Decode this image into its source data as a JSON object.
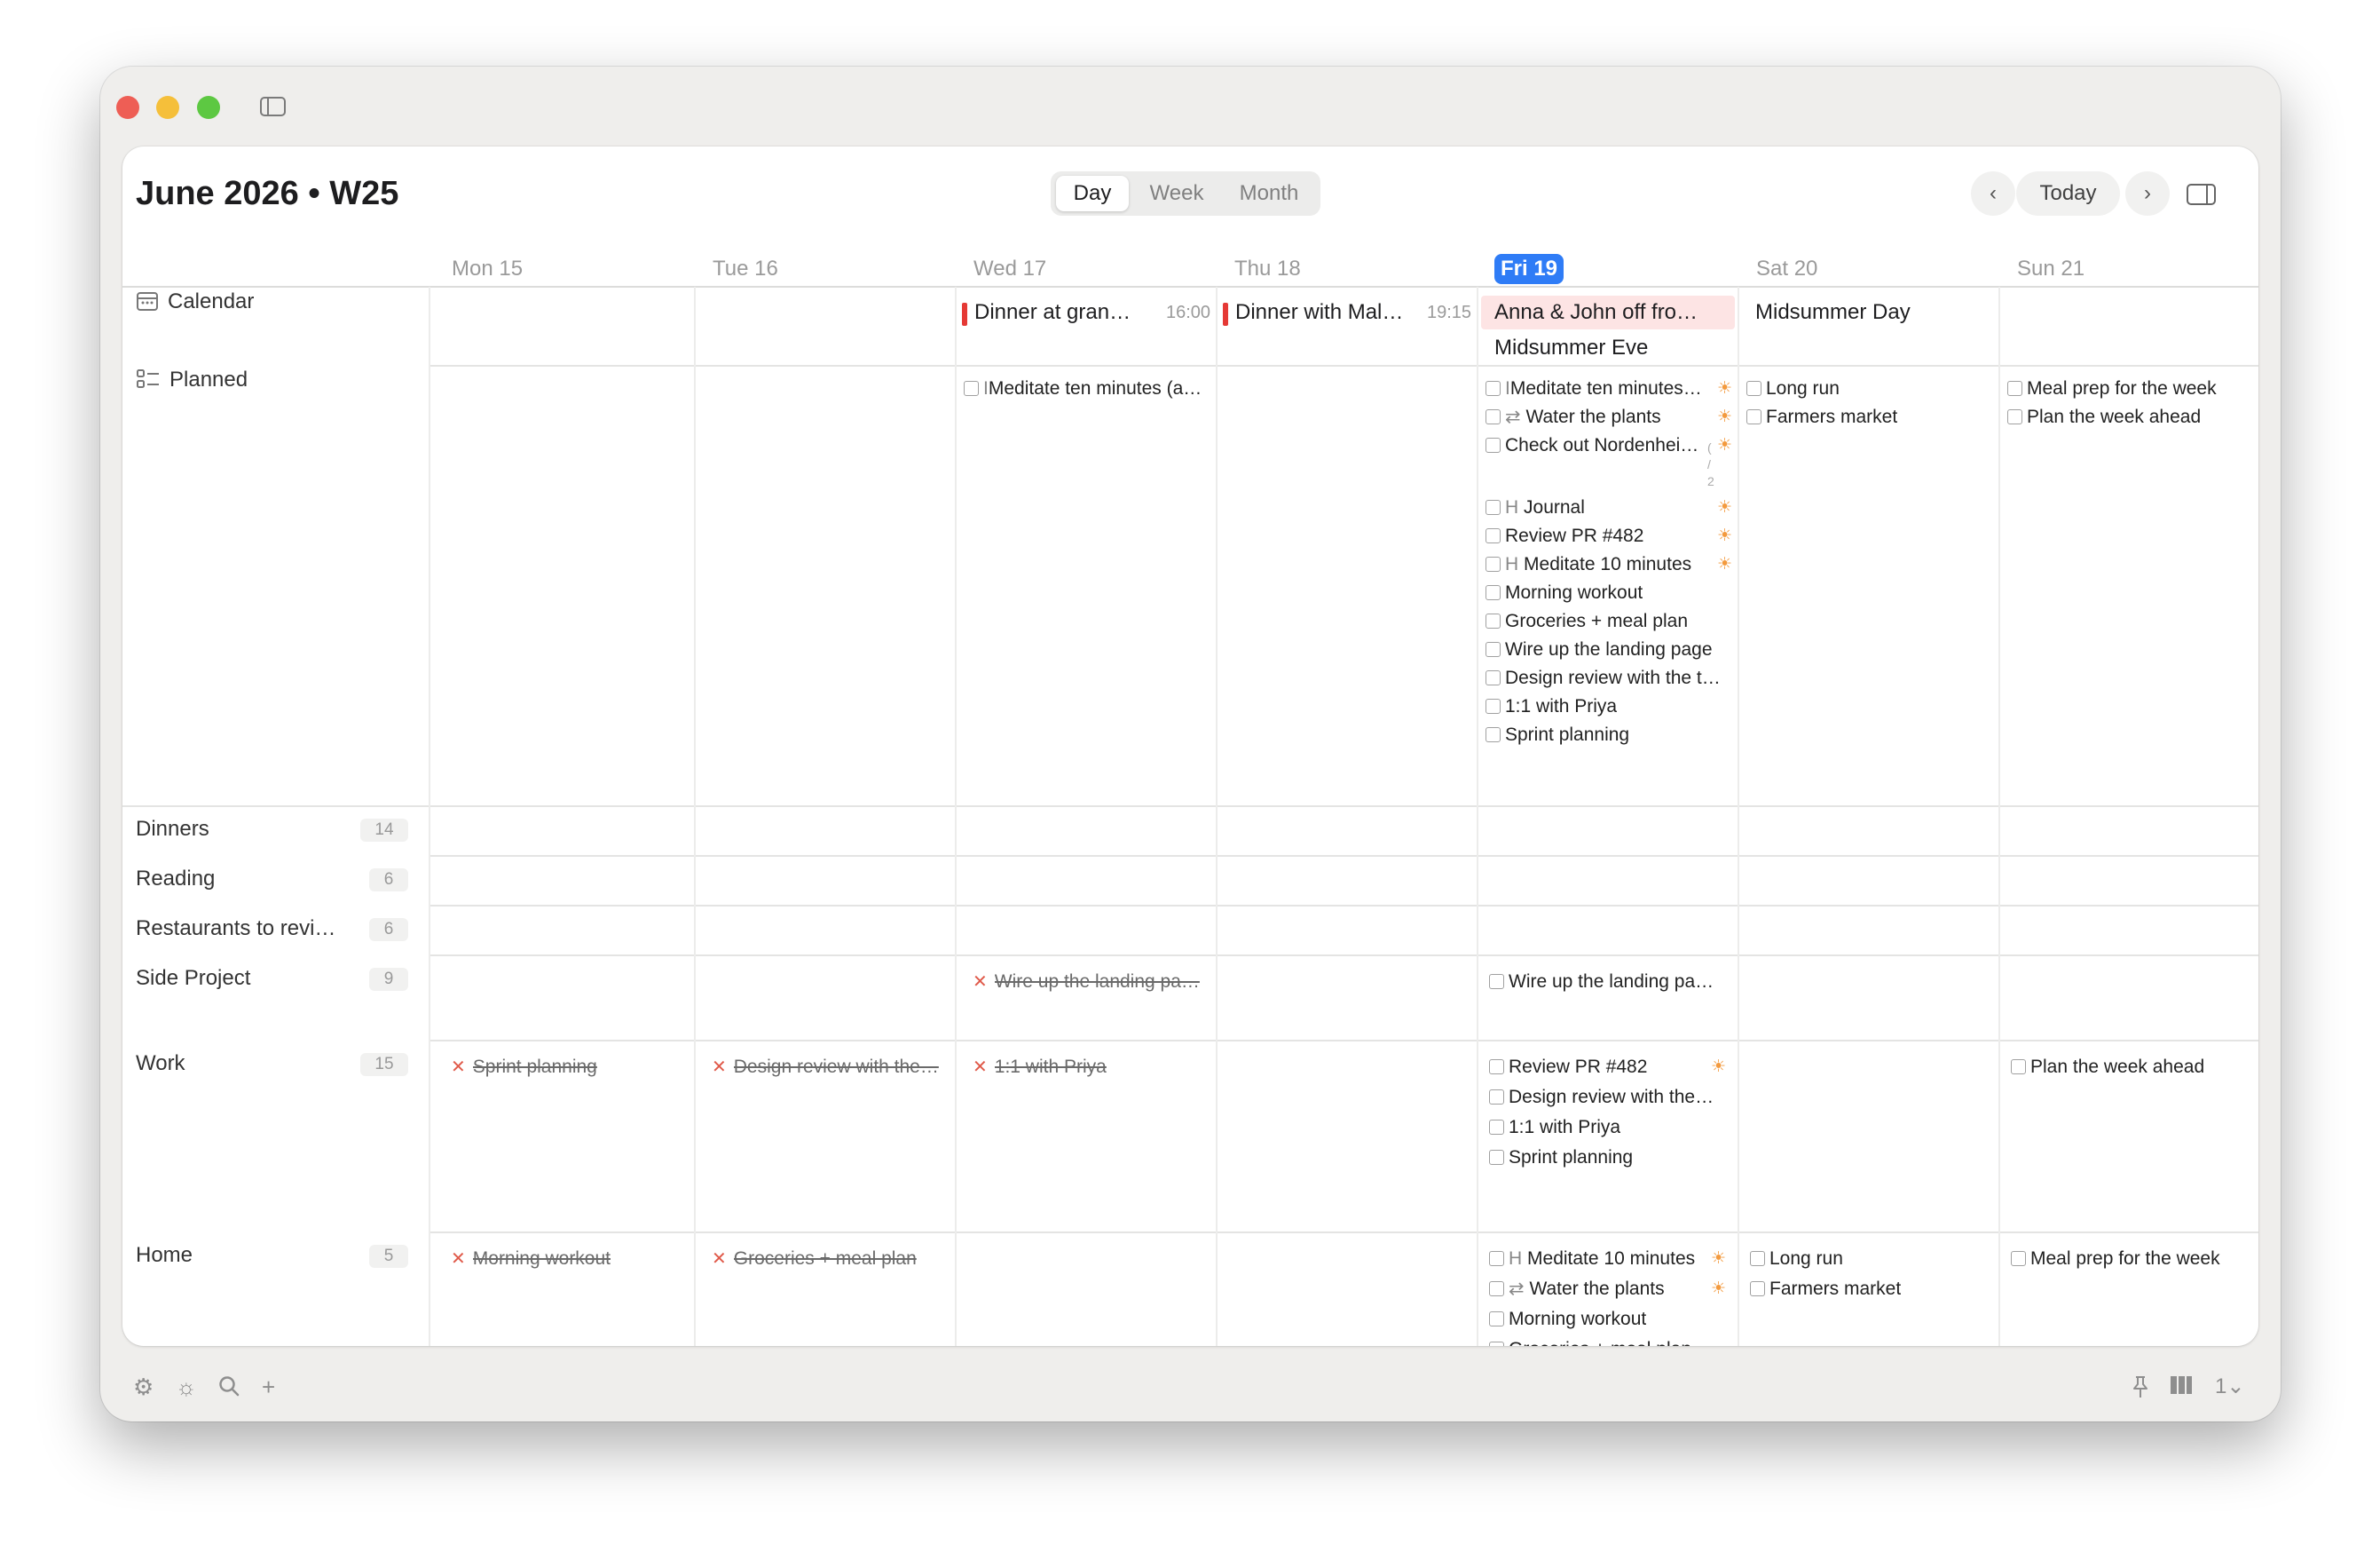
{
  "header": {
    "title": "June 2026 • W25",
    "views": [
      "Day",
      "Week",
      "Month"
    ],
    "active_view": "Day",
    "today_label": "Today"
  },
  "days": [
    "Mon 15",
    "Tue 16",
    "Wed 17",
    "Thu 18",
    "Fri 19",
    "Sat 20",
    "Sun 21"
  ],
  "sidebar": {
    "calendar": "Calendar",
    "planned": "Planned",
    "lists": [
      {
        "name": "Dinners",
        "count": "14"
      },
      {
        "name": "Reading",
        "count": "6"
      },
      {
        "name": "Restaurants to revi…",
        "count": "6"
      },
      {
        "name": "Side Project",
        "count": "9"
      },
      {
        "name": "Work",
        "count": "15"
      },
      {
        "name": "Home",
        "count": "5"
      }
    ]
  },
  "events": {
    "wed": {
      "title": "Dinner at gran…",
      "time": "16:00"
    },
    "thu": {
      "title": "Dinner with Mal…",
      "time": "19:15"
    },
    "fri1": "Anna & John off fro…",
    "fri2": "Midsummer Eve",
    "sat": "Midsummer Day"
  },
  "planned": {
    "wed": [
      {
        "p": "I",
        "t": "Meditate ten minutes (a…"
      }
    ],
    "fri": [
      {
        "p": "I",
        "t": "Meditate ten minutes…"
      },
      {
        "p": "⇄",
        "t": "Water the plants"
      },
      {
        "p": "",
        "t": "Check out Nordenhei…"
      },
      {
        "p": "H",
        "t": "Journal"
      },
      {
        "p": "",
        "t": "Review PR #482"
      },
      {
        "p": "H",
        "t": "Meditate 10 minutes"
      },
      {
        "p": "",
        "t": "Morning workout"
      },
      {
        "p": "",
        "t": "Groceries + meal plan"
      },
      {
        "p": "",
        "t": "Wire up the landing page"
      },
      {
        "p": "",
        "t": "Design review with the t…"
      },
      {
        "p": "",
        "t": "1:1 with Priya"
      },
      {
        "p": "",
        "t": "Sprint planning"
      }
    ],
    "fri_side_note": "( / 2",
    "sat": [
      "Long run",
      "Farmers market"
    ],
    "sun": [
      "Meal prep for the week",
      "Plan the week ahead"
    ]
  },
  "side_project": {
    "wed": "Wire up the landing pa…",
    "fri": "Wire up the landing pa…"
  },
  "work": {
    "mon": "Sprint planning",
    "tue": "Design review with the…",
    "wed": "1:1 with Priya",
    "fri": [
      "Review PR #482",
      "Design review with the…",
      "1:1 with Priya",
      "Sprint planning"
    ],
    "sun": "Plan the week ahead"
  },
  "home": {
    "mon": "Morning workout",
    "tue": "Groceries + meal plan",
    "fri": [
      {
        "p": "H",
        "t": "Meditate 10 minutes"
      },
      {
        "p": "⇄",
        "t": "Water the plants"
      },
      {
        "p": "",
        "t": "Morning workout"
      },
      {
        "p": "",
        "t": "Groceries + meal plan"
      }
    ],
    "sat": [
      "Long run",
      "Farmers market"
    ],
    "sun": "Meal prep for the week"
  },
  "bottom": {
    "zoom": "1⌄"
  },
  "colors": {
    "accent": "#2f7cf6",
    "event_bar": "#e53935",
    "allday_pink": "#fde4e4",
    "overdue_x": "#e05a4a",
    "sun": "#f39a3e"
  }
}
